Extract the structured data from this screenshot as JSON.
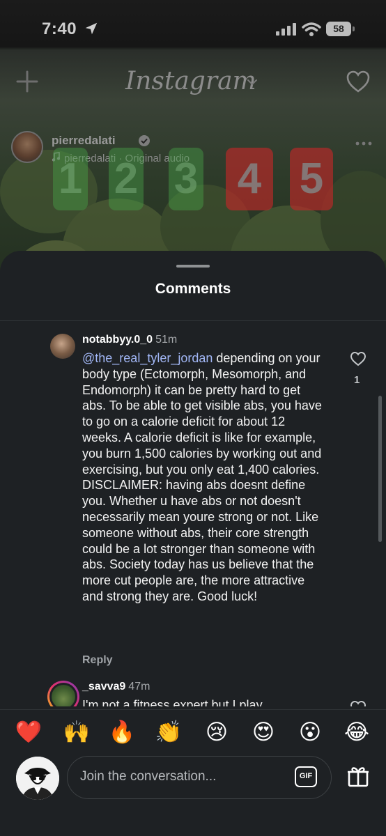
{
  "status_bar": {
    "time": "7:40",
    "battery": "58"
  },
  "header": {
    "logo": "Instagram"
  },
  "post": {
    "username": "pierredalati",
    "audio": "pierredalati · Original audio",
    "tiles": [
      "1",
      "2",
      "3",
      "4",
      "5"
    ]
  },
  "comments_sheet": {
    "title": "Comments",
    "comments": [
      {
        "username": "notabbyy.0_0",
        "time": "51m",
        "mention": "@the_real_tyler_jordan",
        "text": " depending on your body type (Ectomorph, Mesomorph, and Endomorph) it can be pretty hard to get abs. To be able to get visible abs, you have to go on a calorie deficit for about 12 weeks. A calorie deficit is like for example, you burn 1,500 calories by working out and exercising, but you only eat 1,400 calories. DISCLAIMER: having abs doesnt define you. Whether u have abs or not doesn't necessarily mean youre strong or not. Like someone without abs, their core strength could be a lot stronger than someone with abs. Society today has us believe that the more cut people are, the more attractive and strong they are. Good luck!",
        "reply_label": "Reply",
        "likes": "1"
      },
      {
        "username": "_savva9",
        "time": "47m",
        "text": "I'm not a fitness expert but I play"
      }
    ]
  },
  "emoji_bar": [
    "❤️",
    "🙌",
    "🔥",
    "👏",
    "😢",
    "😍",
    "😮",
    "😂"
  ],
  "composer": {
    "placeholder": "Join the conversation...",
    "gif_label": "GIF"
  },
  "colors": {
    "sheet_bg": "#1e2124",
    "mention": "#a2b7f6",
    "red_tile": "#be2828",
    "green_tile": "#46a046"
  }
}
